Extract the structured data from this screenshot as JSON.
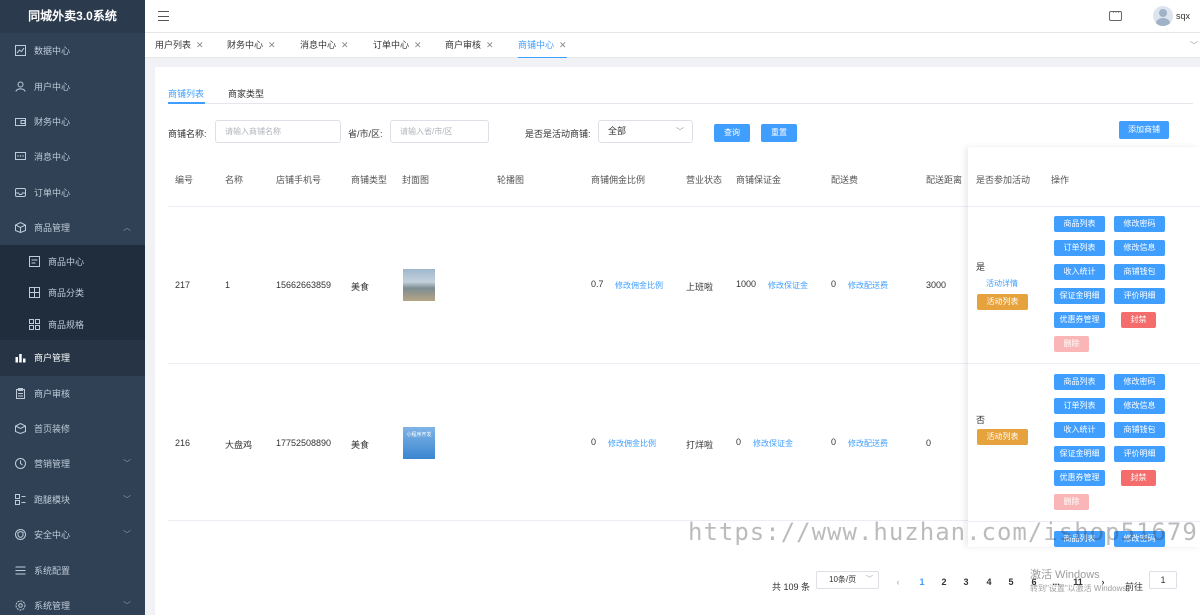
{
  "app": {
    "title": "同城外卖3.0系统",
    "username": "sqx"
  },
  "sidebar": {
    "items": [
      {
        "label": "数据中心",
        "icon": "chart-line-icon"
      },
      {
        "label": "用户中心",
        "icon": "user-icon"
      },
      {
        "label": "财务中心",
        "icon": "wallet-icon"
      },
      {
        "label": "消息中心",
        "icon": "message-icon"
      },
      {
        "label": "订单中心",
        "icon": "inbox-icon"
      },
      {
        "label": "商品管理",
        "icon": "box-icon"
      },
      {
        "label": "商品中心",
        "icon": "document-icon"
      },
      {
        "label": "商品分类",
        "icon": "grid-icon"
      },
      {
        "label": "商品规格",
        "icon": "apps-icon"
      },
      {
        "label": "商户管理",
        "icon": "bar-chart-icon"
      },
      {
        "label": "商户审核",
        "icon": "clipboard-icon"
      },
      {
        "label": "首页装修",
        "icon": "cube-icon"
      },
      {
        "label": "营销管理",
        "icon": "clock-icon"
      },
      {
        "label": "跑腿模块",
        "icon": "modules-icon"
      },
      {
        "label": "安全中心",
        "icon": "shield-icon"
      },
      {
        "label": "系统配置",
        "icon": "list-icon"
      },
      {
        "label": "系统管理",
        "icon": "gear-icon"
      }
    ]
  },
  "tabs": [
    {
      "label": "用户列表"
    },
    {
      "label": "财务中心"
    },
    {
      "label": "消息中心"
    },
    {
      "label": "订单中心"
    },
    {
      "label": "商户审核"
    },
    {
      "label": "商铺中心"
    }
  ],
  "subtabs": [
    {
      "label": "商铺列表"
    },
    {
      "label": "商家类型"
    }
  ],
  "filters": {
    "name_label": "商铺名称:",
    "name_placeholder": "请输入商铺名称",
    "region_label": "省/市/区:",
    "region_placeholder": "请输入省/市/区",
    "active_label": "是否是活动商铺:",
    "active_value": "全部",
    "search_button": "查询",
    "reset_button": "重置",
    "add_button": "添加商铺"
  },
  "table": {
    "headers": [
      "编号",
      "名称",
      "店铺手机号",
      "商铺类型",
      "封面图",
      "轮播图",
      "商铺佣金比例",
      "营业状态",
      "商铺保证金",
      "配送费",
      "配送距离",
      "是否参加活动",
      "操作"
    ],
    "links": {
      "commission": "修改佣金比例",
      "deposit": "修改保证金",
      "fee": "修改配送费",
      "activity_detail": "活动详情",
      "activity_list": "活动列表"
    },
    "thumb2_text": "小程序开发",
    "ops": [
      "商品列表",
      "修改密码",
      "订单列表",
      "修改信息",
      "收入统计",
      "商铺钱包",
      "保证金明细",
      "评价明细",
      "优惠券管理",
      "封禁",
      "删除"
    ],
    "rows": [
      {
        "id": "217",
        "name": "1",
        "phone": "15662663859",
        "type": "美食",
        "commission": "0.7",
        "status": "上班啦",
        "deposit": "1000",
        "fee": "0",
        "distance": "3000",
        "activity": "是"
      },
      {
        "id": "216",
        "name": "大盘鸡",
        "phone": "17752508890",
        "type": "美食",
        "commission": "0",
        "status": "打烊啦",
        "deposit": "0",
        "fee": "0",
        "distance": "0",
        "activity": "否"
      }
    ]
  },
  "pagination": {
    "total": "共 109 条",
    "page_size": "10条/页",
    "prev": "‹",
    "pages": [
      "1",
      "2",
      "3",
      "4",
      "5",
      "6",
      "...",
      "11"
    ],
    "next": "›",
    "goto_label": "前往",
    "goto_value": "1"
  },
  "watermark": "https://www.huzhan.com/ishop51679",
  "windows_activation": {
    "line1": "激活 Windows",
    "line2": "转到\"设置\"以激活 Windows。"
  },
  "colors": {
    "sidebar_bg": "#304156",
    "accent": "#409eff",
    "danger": "#f56c6c",
    "warning": "#e6a23c"
  }
}
